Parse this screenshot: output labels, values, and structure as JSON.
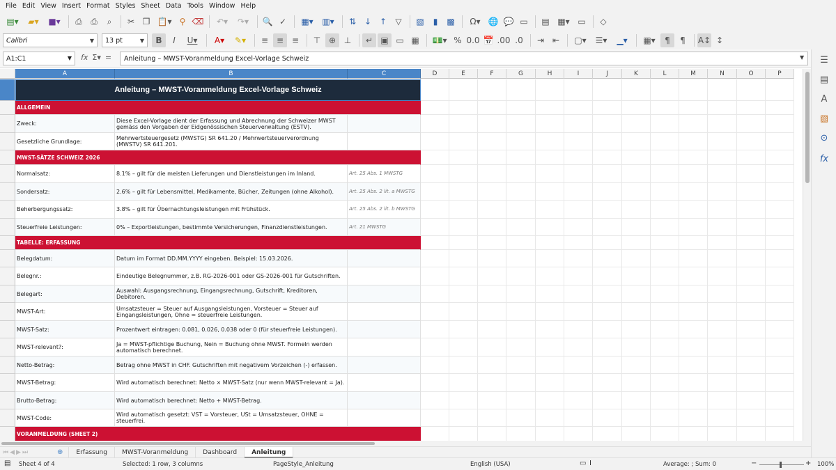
{
  "menu": [
    "File",
    "Edit",
    "View",
    "Insert",
    "Format",
    "Styles",
    "Sheet",
    "Data",
    "Tools",
    "Window",
    "Help"
  ],
  "font": {
    "name": "Calibri",
    "size": "13 pt"
  },
  "formula": {
    "cellref": "A1:C1",
    "content": "Anleitung – MWST-Voranmeldung Excel-Vorlage Schweiz"
  },
  "columns": [
    "A",
    "B",
    "C",
    "D",
    "E",
    "F",
    "G",
    "H",
    "I",
    "J",
    "K",
    "L",
    "M",
    "N",
    "O",
    "P"
  ],
  "rows": {
    "1": {
      "a": "Anleitung – MWST-Voranmeldung Excel-Vorlage Schweiz"
    },
    "2": {
      "a": "ALLGEMEIN"
    },
    "3": {
      "a": "Zweck:",
      "b": "Diese Excel-Vorlage dient der Erfassung und Abrechnung der Schweizer MWST gemäss den Vorgaben der Eidgenössischen Steuerverwaltung (ESTV).",
      "c": ""
    },
    "4": {
      "a": "Gesetzliche Grundlage:",
      "b": "Mehrwertsteuergesetz (MWSTG) SR 641.20 / Mehrwertsteuerverordnung (MWSTV) SR 641.201.",
      "c": ""
    },
    "5": {
      "a": "MWST-SÄTZE SCHWEIZ 2026"
    },
    "6": {
      "a": "Normalsatz:",
      "b": "8.1% – gilt für die meisten Lieferungen und Dienstleistungen im Inland.",
      "c": "Art. 25 Abs. 1 MWSTG"
    },
    "7": {
      "a": "Sondersatz:",
      "b": "2.6% – gilt für Lebensmittel, Medikamente, Bücher, Zeitungen (ohne Alkohol).",
      "c": "Art. 25 Abs. 2 lit. a MWSTG"
    },
    "8": {
      "a": "Beherbergungssatz:",
      "b": "3.8% – gilt für Übernachtungsleistungen mit Frühstück.",
      "c": "Art. 25 Abs. 2 lit. b MWSTG"
    },
    "9": {
      "a": "Steuerfreie Leistungen:",
      "b": "0% – Exportleistungen, bestimmte Versicherungen, Finanzdienstleistungen.",
      "c": "Art. 21 MWSTG"
    },
    "10": {
      "a": "TABELLE: ERFASSUNG"
    },
    "11": {
      "a": "Belegdatum:",
      "b": "Datum im Format DD.MM.YYYY eingeben. Beispiel: 15.03.2026.",
      "c": ""
    },
    "12": {
      "a": "Belegnr.:",
      "b": "Eindeutige Belegnummer, z.B. RG-2026-001 oder GS-2026-001 für Gutschriften.",
      "c": ""
    },
    "13": {
      "a": "Belegart:",
      "b": "Auswahl: Ausgangsrechnung, Eingangsrechnung, Gutschrift, Kreditoren, Debitoren.",
      "c": ""
    },
    "14": {
      "a": "MWST-Art:",
      "b": "Umsatzsteuer = Steuer auf Ausgangsleistungen, Vorsteuer = Steuer auf Eingangsleistungen, Ohne = steuerfreie Leistungen.",
      "c": ""
    },
    "15": {
      "a": "MWST-Satz:",
      "b": "Prozentwert eintragen: 0.081, 0.026, 0.038 oder 0 (für steuerfreie Leistungen).",
      "c": ""
    },
    "16": {
      "a": "MWST-relevant?:",
      "b": "Ja = MWST-pflichtige Buchung, Nein = Buchung ohne MWST. Formeln werden automatisch berechnet.",
      "c": ""
    },
    "17": {
      "a": "Netto-Betrag:",
      "b": "Betrag ohne MWST in CHF. Gutschriften mit negativem Vorzeichen (-) erfassen.",
      "c": ""
    },
    "18": {
      "a": "MWST-Betrag:",
      "b": "Wird automatisch berechnet: Netto × MWST-Satz (nur wenn MWST-relevant = Ja).",
      "c": ""
    },
    "19": {
      "a": "Brutto-Betrag:",
      "b": "Wird automatisch berechnet: Netto + MWST-Betrag.",
      "c": ""
    },
    "20": {
      "a": "MWST-Code:",
      "b": "Wird automatisch gesetzt: VST = Vorsteuer, USt = Umsatzsteuer, OHNE = steuerfrei.",
      "c": ""
    },
    "21": {
      "a": "VORANMELDUNG (SHEET 2)"
    }
  },
  "tabs": [
    "Erfassung",
    "MWST-Voranmeldung",
    "Dashboard",
    "Anleitung"
  ],
  "status": {
    "sheet": "Sheet 4 of 4",
    "selected": "Selected: 1 row, 3 columns",
    "pagestyle": "PageStyle_Anleitung",
    "language": "English (USA)",
    "stats": "Average: ; Sum: 0",
    "zoom": "100%"
  }
}
